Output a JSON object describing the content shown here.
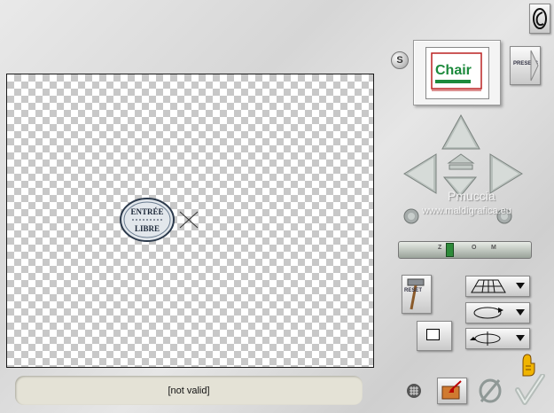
{
  "status_text": "[not valid]",
  "presets_label": "PRESETS",
  "reset_label": "RESET",
  "s_label": "S",
  "watermark": {
    "line1": "Pmuccia",
    "line2": "www.maldigrafica.eu"
  },
  "stamp": {
    "top_text": "ENTRÉE",
    "bottom_text": "LIBRE"
  },
  "preview_text": "Chair",
  "zoom_labels": [
    "Z",
    "O",
    "M"
  ],
  "zoom_level": 0.38,
  "colors": {
    "zoom_thumb": "#2e8b3a",
    "hand_icon": "#f0b400",
    "preview_logo": "#1c8a3c"
  },
  "icons": [
    "logo-icon",
    "presets-arrow-icon",
    "arrow-up-icon",
    "arrow-down-icon",
    "arrow-left-icon",
    "arrow-right-icon",
    "center-up-icon",
    "rotate-left-icon",
    "rotate-right-icon",
    "hammer-icon",
    "perspective-icon",
    "rotate-icon",
    "flip-icon",
    "grid-icon",
    "export-icon",
    "cancel-icon",
    "ok-icon",
    "hand-icon"
  ]
}
